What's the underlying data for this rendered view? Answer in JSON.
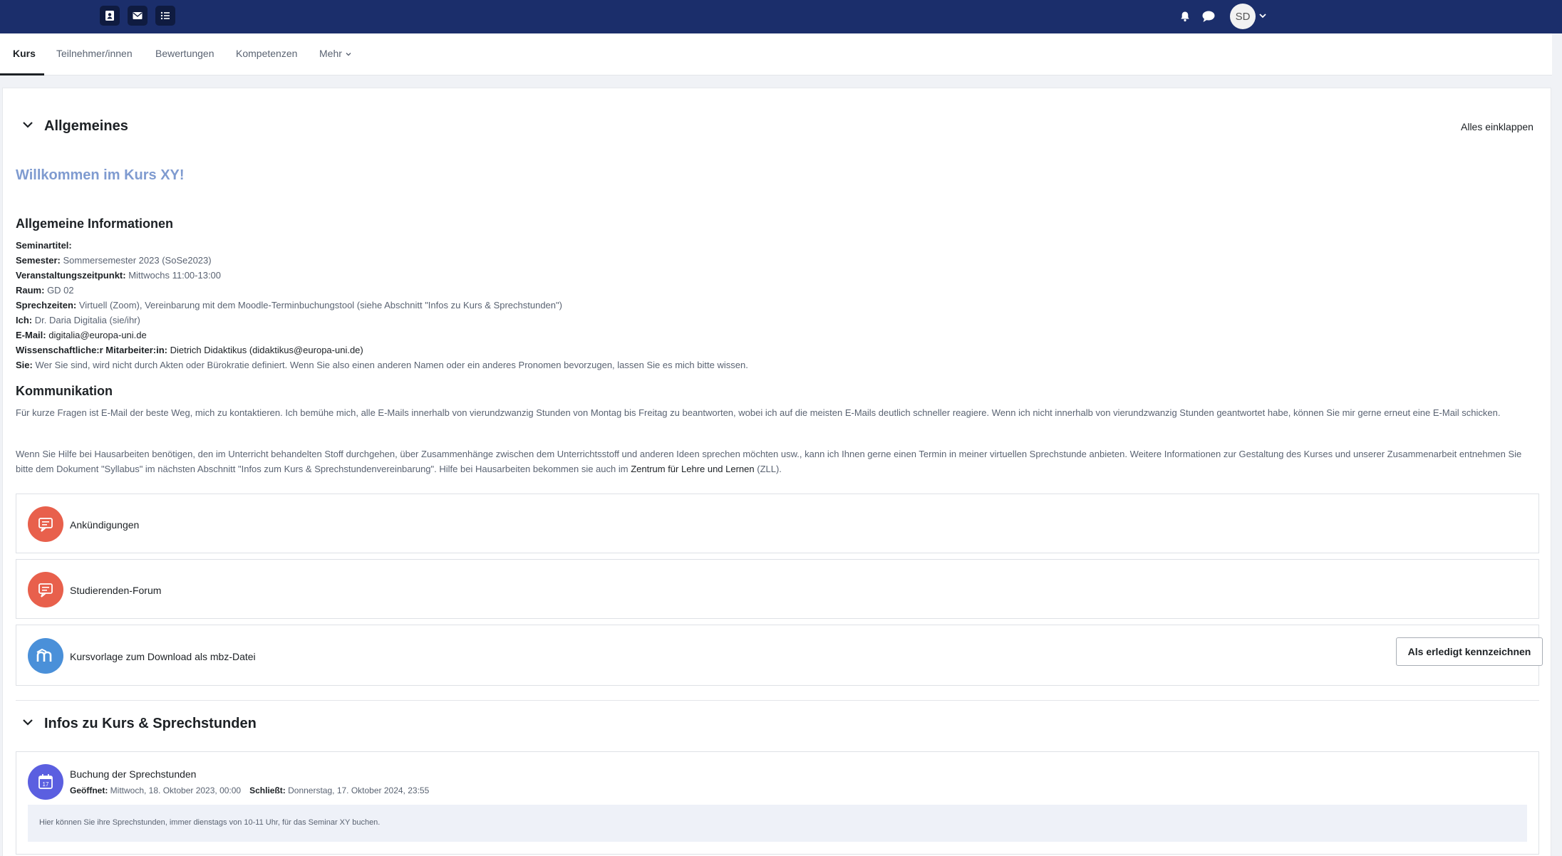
{
  "navbar": {
    "left_icons": [
      "contact-card-icon",
      "mail-icon",
      "list-icon"
    ],
    "right_icons": [
      "bell-icon",
      "chat-bubble-icon"
    ],
    "avatar_initials": "SD"
  },
  "tabs": [
    {
      "label": "Kurs",
      "active": true
    },
    {
      "label": "Teilnehmer/innen"
    },
    {
      "label": "Bewertungen"
    },
    {
      "label": "Kompetenzen"
    },
    {
      "label": "Mehr"
    }
  ],
  "section1": {
    "title": "Allgemeines",
    "collapse_all": "Alles einklappen",
    "welcome": "Willkommen im Kurs XY!",
    "info_heading": "Allgemeine Informationen",
    "info": [
      {
        "label": "Seminartitel:",
        "value": ""
      },
      {
        "label": "Semester:",
        "value": " Sommersemester 2023 (SoSe2023)"
      },
      {
        "label": "Veranstaltungszeitpunkt:",
        "value": " Mittwochs 11:00-13:00"
      },
      {
        "label": "Raum:",
        "value": " GD 02"
      },
      {
        "label": "Sprechzeiten:",
        "value": " Virtuell (Zoom), Vereinbarung mit dem Moodle-Terminbuchungstool (siehe Abschnitt \"Infos zu Kurs & Sprechstunden\")"
      },
      {
        "label": "Ich:",
        "value": " Dr. Daria Digitalia (sie/ihr)"
      },
      {
        "label": "E-Mail:",
        "value": " digitalia@europa-uni.de"
      },
      {
        "label": "Wissenschaftliche:r Mitarbeiter:in:",
        "value": " Dietrich Didaktikus (didaktikus@europa-uni.de)"
      },
      {
        "label": "Sie:",
        "value": " Wer Sie sind, wird nicht durch Akten oder Bürokratie definiert. Wenn Sie also einen anderen Namen oder ein anderes Pronomen bevorzugen, lassen Sie es mich bitte wissen."
      }
    ],
    "comm_heading": "Kommunikation",
    "comm_para1": "Für kurze Fragen ist E-Mail der beste Weg, mich zu kontaktieren. Ich bemühe mich, alle E-Mails innerhalb von vierundzwanzig Stunden von Montag bis Freitag zu beantworten, wobei ich auf die meisten E-Mails deutlich schneller reagiere. Wenn ich nicht innerhalb von vierundzwanzig Stunden geantwortet habe, können Sie mir gerne erneut eine E-Mail schicken.",
    "comm_para2_before": "Wenn Sie Hilfe bei Hausarbeiten benötigen, den im Unterricht behandelten Stoff durchgehen, über Zusammenhänge zwischen dem Unterrichtsstoff und anderen Ideen sprechen möchten usw., kann ich Ihnen gerne einen Termin in meiner virtuellen Sprechstunde anbieten. Weitere Informationen zur Gestaltung des Kurses und unserer Zusammenarbeit entnehmen Sie bitte dem Dokument \"Syllabus\" im nächsten Abschnitt \"Infos zum Kurs & Sprechstundenvereinbarung\". Hilfe bei Hausarbeiten bekommen sie auch im ",
    "comm_para2_link": "Zentrum für Lehre und Lernen",
    "comm_para2_after": " (ZLL).",
    "activities": [
      {
        "name": "Ankündigungen",
        "icon": "forum-icon",
        "color": "#e8604c"
      },
      {
        "name": "Studierenden-Forum",
        "icon": "forum-icon",
        "color": "#e8604c"
      },
      {
        "name": "Kursvorlage zum Download als mbz-Datei",
        "icon": "moodle-icon",
        "color": "#4a90d9",
        "button": "Als erledigt kennzeichnen"
      }
    ]
  },
  "section2": {
    "title": "Infos zu Kurs & Sprechstunden",
    "activity": {
      "name": "Buchung der Sprechstunden",
      "icon": "calendar-icon",
      "color": "#5b5fe0",
      "opened_label": "Geöffnet:",
      "opened_value": " Mittwoch, 18. Oktober 2023, 00:00",
      "closes_label": "Schließt:",
      "closes_value": " Donnerstag, 17. Oktober 2024, 23:55",
      "description": "Hier können Sie ihre Sprechstunden, immer dienstags von 10-11 Uhr, für das Seminar XY buchen."
    }
  }
}
